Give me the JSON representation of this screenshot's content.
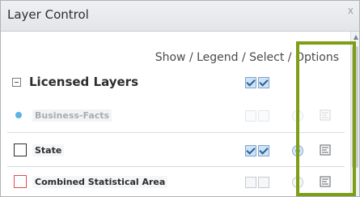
{
  "window": {
    "title": "Layer Control",
    "close": "x"
  },
  "header": {
    "columns_text": "Show / Legend / Select / Options"
  },
  "group": {
    "label": "Licensed Layers"
  },
  "layers": [
    {
      "label": "Business-Facts",
      "icon": "dot-icon"
    },
    {
      "label": "State",
      "icon": "square-outline-icon"
    },
    {
      "label": "Combined Statistical Area",
      "icon": "red-square-outline-icon"
    }
  ],
  "colors": {
    "highlight": "#7e9e18",
    "group_dot": "#5db3e6",
    "red_outline": "#e34b4b"
  }
}
